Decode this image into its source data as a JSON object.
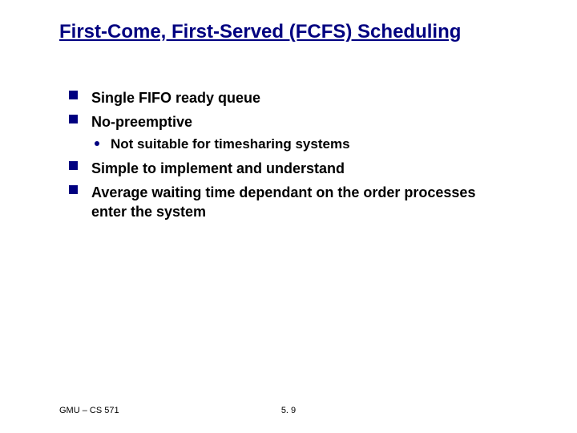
{
  "title": "First-Come, First-Served (FCFS) Scheduling",
  "bullets": {
    "b1": "Single FIFO ready queue",
    "b2": "No-preemptive",
    "b2_sub1": "Not suitable for timesharing systems",
    "b3": "Simple to implement and understand",
    "b4": "Average waiting time dependant on the order processes enter the system"
  },
  "footer": {
    "left": "GMU – CS 571",
    "center": "5. 9"
  },
  "colors": {
    "accent": "#000080"
  }
}
